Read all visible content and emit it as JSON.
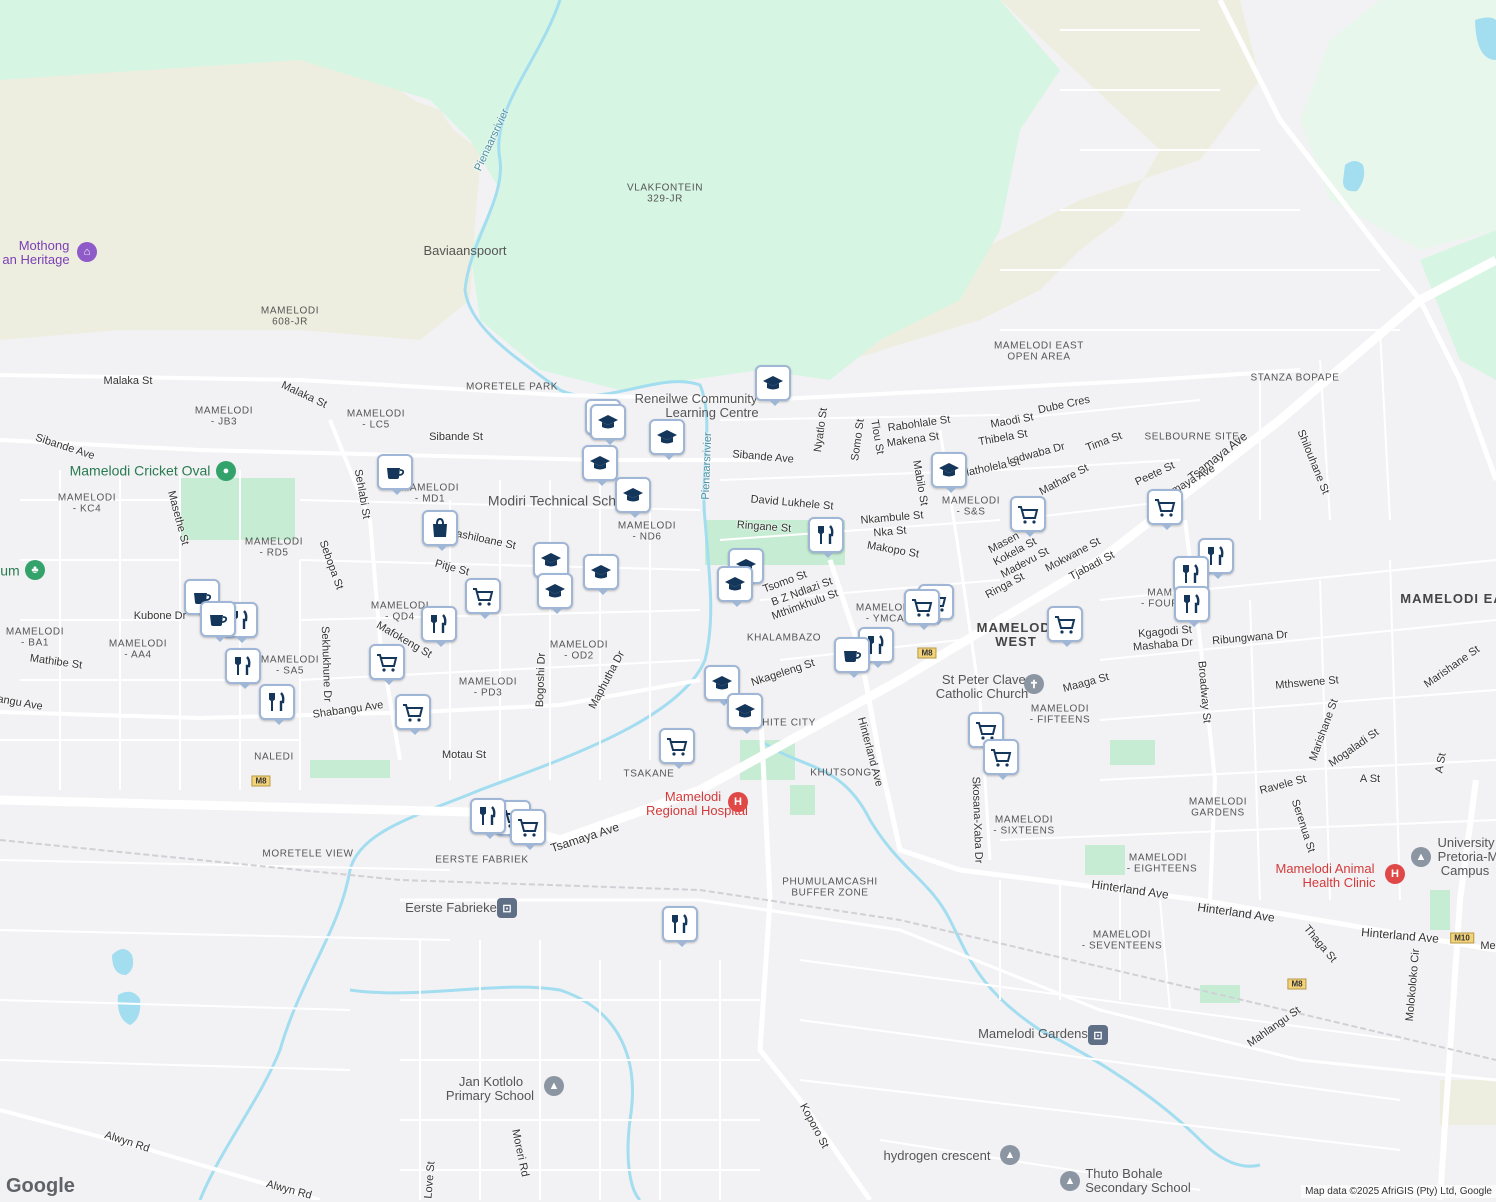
{
  "map": {
    "colors": {
      "land": "#f2f2f4",
      "reserve": "#d7f5e3",
      "dry": "#eeeee0",
      "road": "#ffffff",
      "water": "#a3ddf0",
      "park": "#c6edd3",
      "pin_border": "#9fb6d6",
      "pin_icon": "#14365a"
    },
    "labels": {
      "vlakfontein": "VLAKFONTEIN",
      "vlakfontein2": "329-JR",
      "baviaanspoort": "Baviaanspoort",
      "pienaarsrivier1": "Pienaarsrivier",
      "pienaarsrivier2": "Pienaarsrivier",
      "mothong1": "Mothong",
      "mothong2": "an Heritage",
      "mamelodi608a": "MAMELODI",
      "mamelodi608b": "608-JR",
      "moretele_park": "MORETELE PARK",
      "reneilwe1": "Reneilwe Community",
      "reneilwe2": "Learning Centre",
      "mamelodi_east_open1": "MAMELODI EAST",
      "mamelodi_east_open2": "OPEN AREA",
      "stanza": "STANZA BOPAPE",
      "selbourne": "SELBOURNE SITE",
      "malaka1": "Malaka St",
      "malaka2": "Malaka St",
      "jb3a": "MAMELODI",
      "jb3b": "- JB3",
      "lc5a": "MAMELODI",
      "lc5b": "- LC5",
      "sibande_ave1": "Sibande Ave",
      "sibande_st": "Sibande St",
      "sibande_ave2": "Sibande Ave",
      "cricket": "Mamelodi Cricket Oval",
      "kc4a": "MAMELODI",
      "kc4b": "- KC4",
      "md1a": "MAMELODI",
      "md1b": "- MD1",
      "modiri": "Modiri Technical Sch",
      "nd6a": "MAMELODI",
      "nd6b": "- ND6",
      "rd5a": "MAMELODI",
      "rd5b": "- RD5",
      "museum": "um",
      "sehlabi": "Sehlabi St",
      "masethe": "Masethe St",
      "sebopa": "Sebopa St",
      "pitje": "Pitje St",
      "mashiloane": "ashiloane St",
      "kubone": "Kubone Dr",
      "ba1a": "MAMELODI",
      "ba1b": "- BA1",
      "aa4a": "MAMELODI",
      "aa4b": "- AA4",
      "mathibe": "Mathibe St",
      "qd4a": "MAMELODI",
      "qd4b": "- QD4",
      "mafokeng": "Mafokeng St",
      "sa5a": "MAMELODI",
      "sa5b": "- SA5",
      "sekhukhune": "Sekhukhune Dr",
      "od2a": "MAMELODI",
      "od2b": "- OD2",
      "bogoshi": "Bogoshi Dr",
      "maphutha": "Maphutha Dr",
      "pd3a": "MAMELODI",
      "pd3b": "- PD3",
      "shabangu_ave1": "Shabangu Ave",
      "shabangu_ave2": "angu Ave",
      "naledi": "NALEDI",
      "motau": "Motau St",
      "tsakane": "TSAKANE",
      "moretele_view": "MORETELE VIEW",
      "eerste": "EERSTE FABRIEK",
      "eerste_station": "Eerste Fabrieke",
      "tsamaya1": "Tsamaya Ave",
      "tsamaya2": "Tsamaya Ave",
      "hospital1": "Mamelodi",
      "hospital2": "Regional Hospital",
      "m8a": "M8",
      "m8b": "M8",
      "m8c": "M8",
      "m10": "M10",
      "white_city": "WHITE CITY",
      "khalambazo": "KHALAMBAZO",
      "khutsong": "KHUTSONG",
      "phumulamcashi1": "PHUMULAMCASHI",
      "phumulamcashi2": "BUFFER ZONE",
      "nkageleng": "Nkageleng St",
      "tsomo": "Tsomo St",
      "bzndlazi": "B Z Ndlazi St",
      "mthimkhulu": "Mthimkhulu St",
      "ringane": "Ringane St",
      "david": "David Lukhele St",
      "nkambule": "Nkambule St",
      "nka": "Nka St",
      "makopo": "Makopo St",
      "nyatlo": "Nyatlo St",
      "somo": "Somo St",
      "tlou": "Tlou St",
      "mabilo": "Mabilo St",
      "rabohlale": "Rabohlale St",
      "makena": "Makena St",
      "maodi": "Maodi St",
      "thibela": "Thibela St",
      "dube": "Dube Cres",
      "ledwaba": "Ledwaba Dr",
      "tima": "Tima St",
      "matholela": "Matholela St",
      "ss_a": "MAMELODI",
      "ss_b": "- S&S",
      "mathare": "Mathare St",
      "peete": "Peete St",
      "masen": "Masen",
      "kokela": "Kokela St",
      "madevu": "Madevu St",
      "mokwane": "Mokwane St",
      "ringa": "Ringa St",
      "tjabadi": "Tjabadi St",
      "ymca_a": "MAMELODI",
      "ymca_b": "- YMCA",
      "mamelodi_west1": "MAMELODI",
      "mamelodi_west2": "WEST",
      "hinterland1": "Hinterland Ave",
      "hinterland2": "Hinterland Ave",
      "hinterland3": "Hinterland Ave",
      "hinterland4": "Hinterland Ave",
      "stpeter1": "St Peter Claver",
      "stpeter2": "Catholic Church",
      "maaga": "Maaga St",
      "fifteens_a": "MAMELODI",
      "fifteens_b": "- FIFTEENS",
      "sixteens_a": "MAMELODI",
      "sixteens_b": "- SIXTEENS",
      "skosana": "Skosana-Xaba Dr",
      "eighteens_a": "MAMELODI",
      "eighteens_b": "- EIGHTEENS",
      "seventeens_a": "MAMELODI",
      "seventeens_b": "- SEVENTEENS",
      "kgagodi": "Kgagodi St",
      "mashaba": "Mashaba Dr",
      "ribungwana": "Ribungwana Dr",
      "broadway": "Broadway St",
      "four_a": "MAM",
      "four_b": "- FOUR",
      "mthswene": "Mthswene St",
      "marishane1": "Marishane St",
      "marishane2": "Marishane St",
      "mogaladi": "Mogaladi St",
      "a_st1": "A St",
      "a_st2": "A St",
      "ravele": "Ravele St",
      "serenua": "Serenua St",
      "gardens_a": "MAMELODI",
      "gardens_b": "GARDENS",
      "animal1": "Mamelodi Animal",
      "animal2": "Health Clinic",
      "univ1": "University",
      "univ2": "Pretoria-M",
      "univ3": "Campus",
      "thaga": "Thaga St",
      "mahlangu": "Mahlangu St",
      "molokoloko": "Molokoloko Cir",
      "shilouhane": "Shilouhane St",
      "mamelodi_east": "MAMELODI EA",
      "mamelodi_gardens": "Mamelodi Gardens",
      "koporo": "Koporo St",
      "jan1": "Jan Kotlolo",
      "jan2": "Primary School",
      "moreri": "Moreri Rd",
      "love": "Love St",
      "alwyn1": "Alwyn Rd",
      "alwyn2": "Alwyn Rd",
      "hydrogen": "hydrogen crescent",
      "thuto1": "Thuto Bohale",
      "thuto2": "Secondary School",
      "tsamaya_e": "Tsamaya Ave",
      "m_e": "Me"
    },
    "attribution": "Map data ©2025 AfriGIS (Pty) Ltd, Google",
    "logo": "Google"
  }
}
